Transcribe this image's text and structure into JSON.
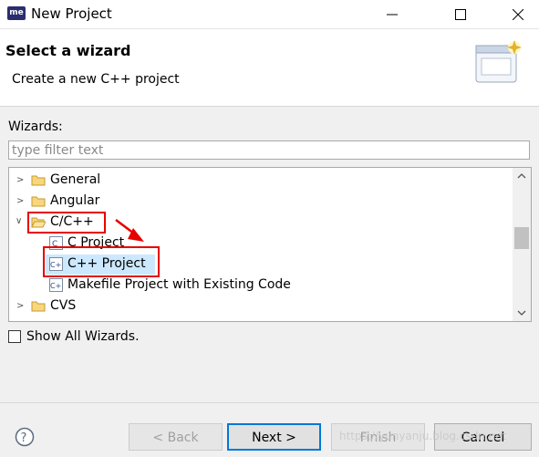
{
  "window": {
    "title": "New Project",
    "app_icon_text": "me"
  },
  "banner": {
    "title": "Select a wizard",
    "description": "Create a new C++ project"
  },
  "wizards_label": "Wizards:",
  "filter": {
    "placeholder": "type filter text",
    "value": ""
  },
  "tree": {
    "items": [
      {
        "label": "General"
      },
      {
        "label": "Angular"
      },
      {
        "label": "C/C++"
      },
      {
        "label": "C Project"
      },
      {
        "label": "C++ Project"
      },
      {
        "label": "Makefile Project with Existing Code"
      },
      {
        "label": "CVS"
      }
    ]
  },
  "show_all": {
    "label": "Show All Wizards.",
    "checked": false
  },
  "buttons": {
    "back": "< Back",
    "next": "Next >",
    "finish": "Finish",
    "cancel": "Cancel"
  },
  "watermark": "https://yunyanju.blog.csdn.net",
  "colors": {
    "highlight": "#e60000",
    "selection": "#cce8ff",
    "default_button_border": "#0078d7"
  }
}
